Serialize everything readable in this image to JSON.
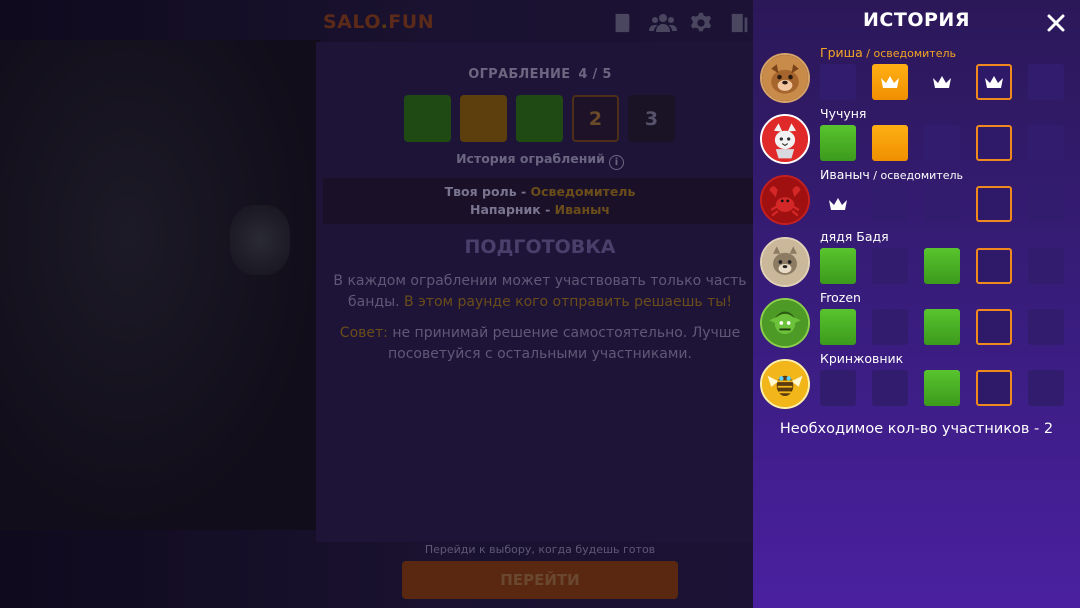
{
  "topbar": {
    "logo_main": "SALO",
    "logo_dot": ".",
    "logo_tld": "FUN",
    "icons": [
      "book-icon",
      "users-icon",
      "gear-icon",
      "exit-icon"
    ]
  },
  "heist": {
    "label": "ОГРАБЛЕНИЕ",
    "progress": "4 / 5",
    "rounds": [
      {
        "state": "success",
        "text": ""
      },
      {
        "state": "fail",
        "text": ""
      },
      {
        "state": "success",
        "text": ""
      },
      {
        "state": "current",
        "text": "2"
      },
      {
        "state": "upcoming",
        "text": "3"
      }
    ],
    "history_link": "История ограблений"
  },
  "role_info": {
    "role_label": "Твоя роль - ",
    "role_value": "Осведомитель",
    "partner_label": "Напарник - ",
    "partner_value": "Иваныч"
  },
  "phase": {
    "title": "ПОДГОТОВКА",
    "text_1": "В каждом ограблении может участвовать только часть банды. ",
    "text_1_highlight": "В этом раунде кого отправить решаешь ты!",
    "tip_label": "Совет:",
    "tip_text": " не принимай решение самостоятельно. Лучше посоветуйся с остальными участниками."
  },
  "footer": {
    "hint": "Перейди к выбору, когда будешь готов",
    "go_label": "ПЕРЕЙТИ"
  },
  "history_panel": {
    "title": "ИСТОРИЯ",
    "close_icon": "close-icon",
    "players": [
      {
        "name": "Гриша",
        "role": " / осведомитель",
        "me": true,
        "cells": [
          "empty",
          "orange-crown",
          "crown",
          "outline-crown",
          "empty"
        ]
      },
      {
        "name": "Чучуня",
        "role": "",
        "me": false,
        "cells": [
          "green",
          "orange",
          "empty",
          "outline",
          "empty"
        ]
      },
      {
        "name": "Иваныч",
        "role": " / осведомитель",
        "me": false,
        "cells": [
          "crown",
          "empty",
          "empty",
          "outline",
          "empty"
        ]
      },
      {
        "name": "дядя Бадя",
        "role": "",
        "me": false,
        "cells": [
          "green",
          "empty",
          "green",
          "outline",
          "empty"
        ]
      },
      {
        "name": "Frozen",
        "role": "",
        "me": false,
        "cells": [
          "green",
          "empty",
          "green",
          "outline",
          "empty"
        ]
      },
      {
        "name": "Кринжовник",
        "role": "",
        "me": false,
        "cells": [
          "empty",
          "empty",
          "green",
          "outline",
          "empty"
        ]
      }
    ],
    "required": "Необходимое кол-во участников - 2"
  },
  "colors": {
    "panel_bg": "#3a1d80",
    "accent_orange": "#f5a623",
    "success_green": "#4cb024",
    "slot_outline": "#f08a1e"
  }
}
